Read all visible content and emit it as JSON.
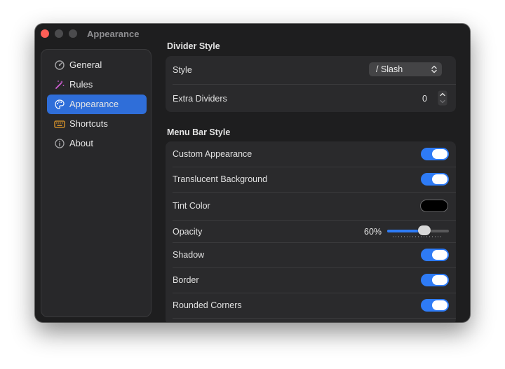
{
  "window": {
    "title": "Appearance"
  },
  "sidebar": {
    "items": [
      {
        "label": "General",
        "icon": "gauge-icon",
        "active": false
      },
      {
        "label": "Rules",
        "icon": "magic-wand-icon",
        "active": false
      },
      {
        "label": "Appearance",
        "icon": "palette-icon",
        "active": true
      },
      {
        "label": "Shortcuts",
        "icon": "keyboard-icon",
        "active": false
      },
      {
        "label": "About",
        "icon": "info-icon",
        "active": false
      }
    ]
  },
  "divider_style": {
    "title": "Divider Style",
    "style": {
      "label": "Style",
      "value": "/  Slash"
    },
    "extra_dividers": {
      "label": "Extra Dividers",
      "value": "0"
    }
  },
  "menu_bar_style": {
    "title": "Menu Bar Style",
    "custom_appearance": {
      "label": "Custom Appearance",
      "on": true
    },
    "translucent_background": {
      "label": "Translucent Background",
      "on": true
    },
    "tint_color": {
      "label": "Tint Color",
      "color": "#000000"
    },
    "opacity": {
      "label": "Opacity",
      "value_text": "60%",
      "fraction": 0.6
    },
    "shadow": {
      "label": "Shadow",
      "on": true
    },
    "border": {
      "label": "Border",
      "on": true
    },
    "rounded_corners": {
      "label": "Rounded Corners",
      "on": true
    }
  },
  "colors": {
    "accent": "#2e7bf6",
    "sidebar_selected": "#2f6ed9",
    "close_button": "#fe5f57"
  }
}
